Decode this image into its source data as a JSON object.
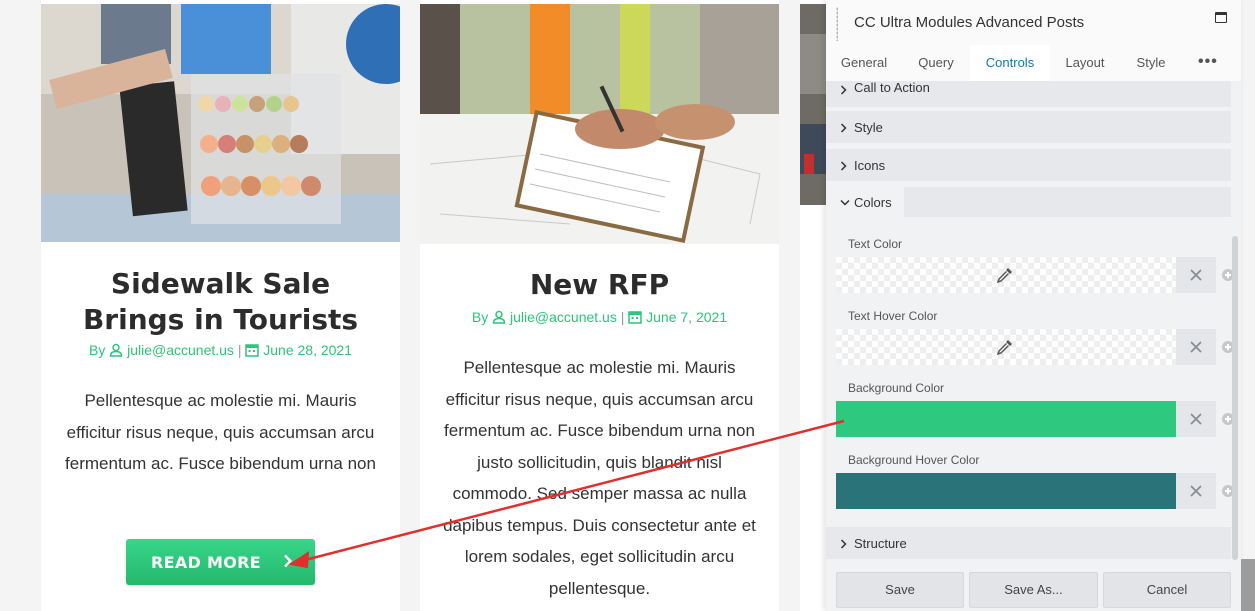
{
  "cards": [
    {
      "title_lines": [
        "Sidewalk Sale",
        "Brings in Tourists"
      ],
      "by": "By",
      "author": "julie@accunet.us",
      "separator": "|",
      "date": "June 28, 2021",
      "excerpt": "Pellentesque ac molestie mi. Mauris efficitur risus neque, quis accumsan arcu fermentum ac. Fusce bibendum urna non",
      "read_more": "READ MORE"
    },
    {
      "title_lines": [
        "New RFP"
      ],
      "by": "By",
      "author": "julie@accunet.us",
      "separator": "|",
      "date": "June 7, 2021",
      "excerpt": "Pellentesque ac molestie mi. Mauris efficitur risus neque, quis accumsan arcu fermentum ac. Fusce bibendum urna non justo sollicitudin, quis blandit nisl commodo. Sed semper massa ac nulla dapibus tempus. Duis consectetur ante et lorem sodales, eget sollicitudin arcu pellentesque."
    }
  ],
  "panel": {
    "title": "CC Ultra Modules Advanced Posts",
    "tabs": [
      "General",
      "Query",
      "Controls",
      "Layout",
      "Style"
    ],
    "active_tab": "Controls",
    "more_label": "•••",
    "sections": [
      "Call to Action",
      "Style",
      "Icons"
    ],
    "open_section": "Colors",
    "color_fields": [
      {
        "label": "Text Color",
        "value": null
      },
      {
        "label": "Text Hover Color",
        "value": null
      },
      {
        "label": "Background Color",
        "value": "#2ec87e"
      },
      {
        "label": "Background Hover Color",
        "value": "#2a7479"
      }
    ],
    "after_section": "Structure",
    "buttons": {
      "save": "Save",
      "save_as": "Save As...",
      "cancel": "Cancel"
    }
  },
  "colors": {
    "accent_green": "#2ec47a",
    "link_blue": "#0e7bb0",
    "annotation_red": "#e0302e"
  }
}
